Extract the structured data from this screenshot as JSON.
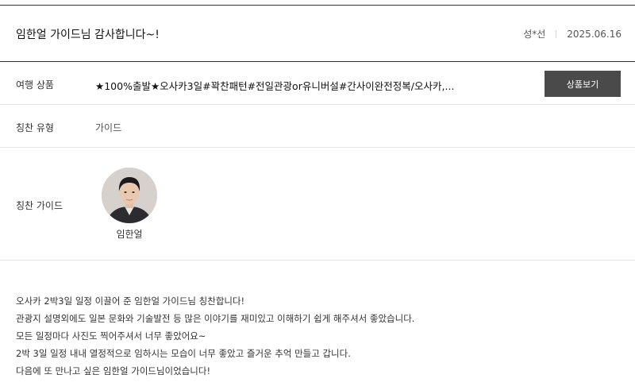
{
  "review": {
    "title": "임한얼 가이드님 감사합니다~!",
    "author": "성*선",
    "date": "2025.06.16"
  },
  "product": {
    "label": "여행 상품",
    "value": "★100%출발★오사카3일#꽉찬패턴#전일관광or유니버설#간사이완전정복/오사카,...",
    "button_label": "상품보기"
  },
  "praise_type": {
    "label": "칭찬 유형",
    "value": "가이드"
  },
  "praise_guide": {
    "label": "칭찬 가이드",
    "name": "임한얼"
  },
  "content": {
    "lines": [
      "오사카 2박3일 일정 이끌어 준 임한얼 가이드님 칭찬합니다!",
      "관광지 설명외에도 일본 문화와 기술발전 등 많은 이야기를 재미있고 이해하기 쉽게 해주셔서 좋았습니다.",
      "모든 일정마다 사진도 찍어주셔서 너무 좋았어요~",
      "2박 3일 일정 내내 열정적으로 임하시는 모습이 너무 좋았고 즐거운 추억 만들고 갑니다.",
      "다음에 또 만나고 싶은 임한얼 가이드님이었습니다!"
    ]
  }
}
